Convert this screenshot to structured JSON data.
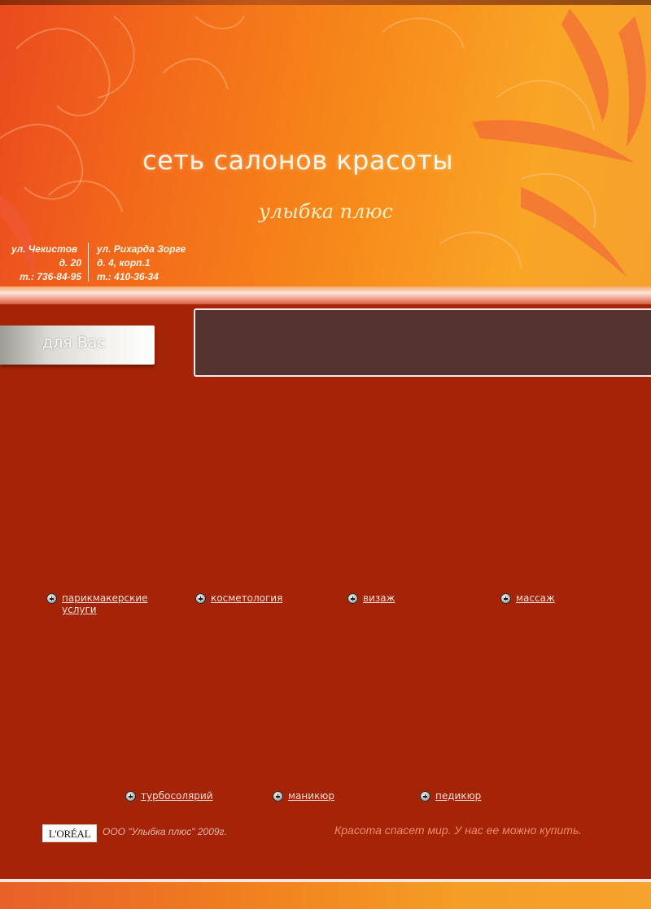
{
  "colors": {
    "background": "#a52407",
    "panel": "#553331",
    "link": "#f6e0d6",
    "header_start": "#ea4a1f",
    "header_end": "#f9a526",
    "slogan": "#ed8b6d"
  },
  "header": {
    "title": "сеть салонов красоты",
    "subtitle": "улыбка плюс",
    "address_left": {
      "street": "ул. Чекистов",
      "house": "д. 20",
      "phone": "т.: 736-84-95"
    },
    "address_right": {
      "street": "ул. Рихарда Зорге",
      "house": "д. 4, корп.1",
      "phone": "т.: 410-36-34"
    }
  },
  "sidebar": {
    "tab_label": "для Вас"
  },
  "nav_top": [
    {
      "label": "парикмакерские услуги",
      "icon": "plus-circle-icon"
    },
    {
      "label": "косметология",
      "icon": "plus-circle-icon"
    },
    {
      "label": "визаж",
      "icon": "plus-circle-icon"
    },
    {
      "label": "массаж",
      "icon": "plus-circle-icon"
    }
  ],
  "nav_bottom": [
    {
      "label": "турбосолярий",
      "icon": "plus-circle-icon"
    },
    {
      "label": "маникюр",
      "icon": "plus-circle-icon"
    },
    {
      "label": "педикюр",
      "icon": "plus-circle-icon"
    }
  ],
  "footer": {
    "brand": "L'ORÉAL",
    "copyright": "ООО \"Улыбка плюс\" 2009г.",
    "slogan": "Красота спасет мир. У нас ее можно купить."
  }
}
